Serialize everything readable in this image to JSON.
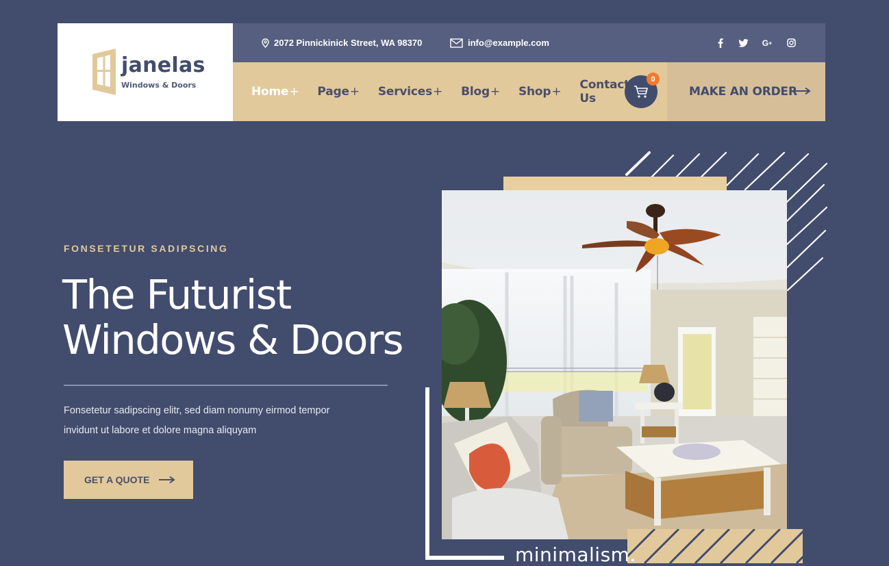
{
  "brand": {
    "name": "janelas",
    "tagline": "Windows & Doors",
    "logo_icon": "window-icon"
  },
  "topbar": {
    "address": "2072 Pinnickinick Street, WA 98370",
    "address_icon": "map-pin-icon",
    "email": "info@example.com",
    "email_icon": "envelope-icon",
    "socials": [
      {
        "name": "facebook",
        "glyph": "f"
      },
      {
        "name": "twitter",
        "glyph": "t"
      },
      {
        "name": "google-plus",
        "glyph": "G+"
      },
      {
        "name": "instagram",
        "glyph": "ig"
      }
    ]
  },
  "nav": {
    "items": [
      {
        "label": "Home",
        "suffix": "+",
        "active": true
      },
      {
        "label": "Page",
        "suffix": "+"
      },
      {
        "label": "Services",
        "suffix": "+"
      },
      {
        "label": "Blog",
        "suffix": "+"
      },
      {
        "label": "Shop",
        "suffix": "+"
      },
      {
        "label": "Contact Us",
        "suffix": ""
      }
    ],
    "cart_count": "0",
    "order_button": "MAKE AN ORDER"
  },
  "hero": {
    "eyebrow": "FONSETETUR SADIPSCING",
    "title_line1": "The Futurist",
    "title_line2": "Windows & Doors",
    "desc_line1": "Fonsetetur sadipscing elitr, sed diam nonumy eirmod tempor",
    "desc_line2": "invidunt ut labore et dolore magna aliquyam",
    "cta": "GET A QUOTE",
    "image_alt": "Bright living room with ceiling fan, sofa, armchair and coffee table",
    "caption": "minimalism."
  },
  "colors": {
    "background": "#424c6d",
    "topbar": "#565f7f",
    "accent_beige": "#e2c99b",
    "order_bg": "#d6bf98",
    "badge": "#f27a2c",
    "white": "#ffffff"
  }
}
